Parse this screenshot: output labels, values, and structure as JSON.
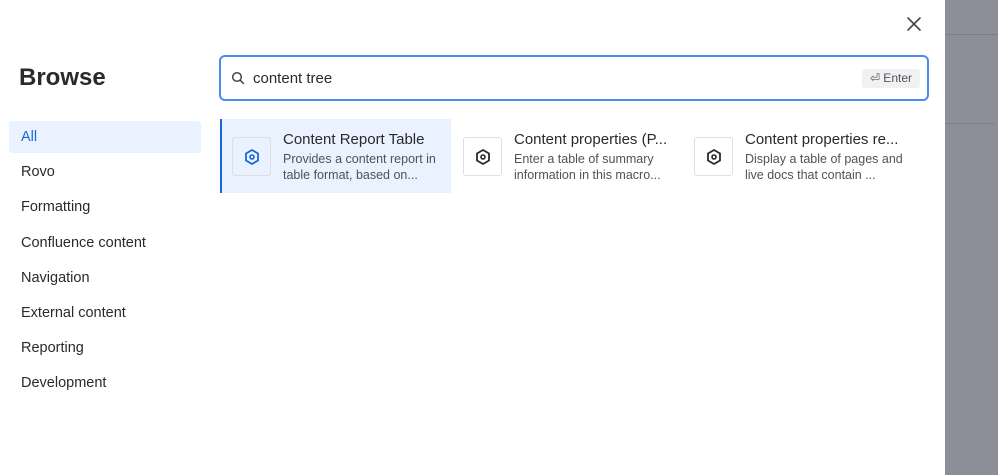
{
  "dialog": {
    "title": "Browse",
    "close_icon": "close-icon"
  },
  "sidebar": {
    "items": [
      {
        "label": "All",
        "active": true
      },
      {
        "label": "Rovo"
      },
      {
        "label": "Formatting"
      },
      {
        "label": "Confluence content"
      },
      {
        "label": "Navigation"
      },
      {
        "label": "External content"
      },
      {
        "label": "Reporting"
      },
      {
        "label": "Development"
      }
    ]
  },
  "search": {
    "value": "content tree",
    "hint": "⏎ Enter",
    "icon": "search-icon"
  },
  "results": [
    {
      "title": "Content Report Table",
      "desc": "Provides a content report in table format, based on..."
    },
    {
      "title": "Content properties (P...",
      "desc": "Enter a table of summary information in this macro..."
    },
    {
      "title": "Content properties re...",
      "desc": "Display a table of pages and live docs that contain ..."
    }
  ],
  "colors": {
    "accent": "#1868db",
    "active_bg": "#e9f2fe",
    "focus_border": "#4c8af0"
  }
}
